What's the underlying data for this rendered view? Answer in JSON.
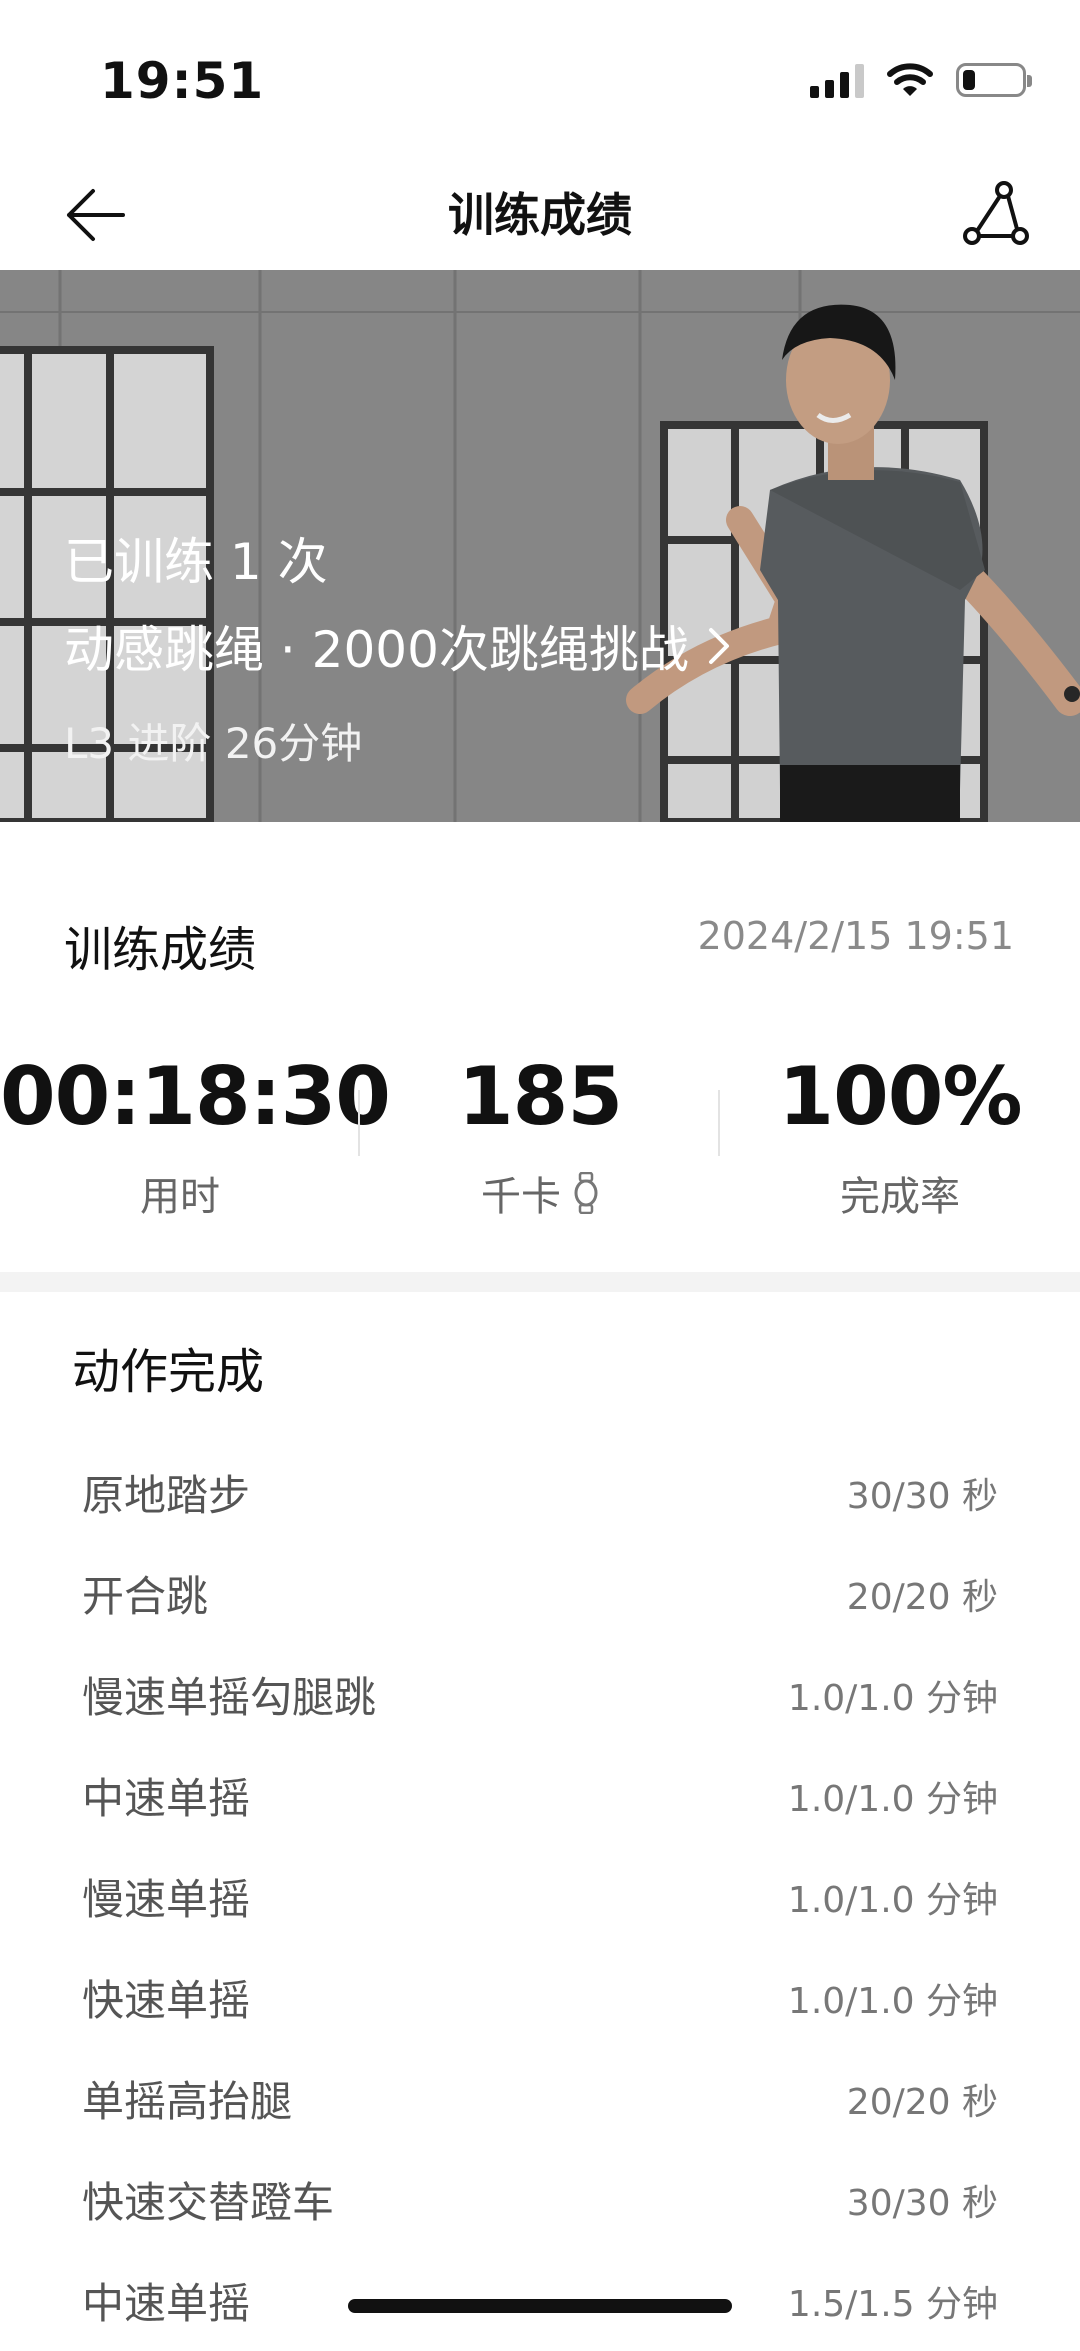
{
  "status_bar": {
    "time": "19:51"
  },
  "header": {
    "title": "训练成绩"
  },
  "hero": {
    "count_text": "已训练 1 次",
    "course_text": "动感跳绳 · 2000次跳绳挑战",
    "level_text": "L3 进阶 26分钟"
  },
  "results": {
    "title": "训练成绩",
    "date": "2024/2/15 19:51",
    "stats": [
      {
        "value": "00:18:30",
        "label": "用时"
      },
      {
        "value": "185",
        "label": "千卡"
      },
      {
        "value": "100%",
        "label": "完成率"
      }
    ]
  },
  "actions": {
    "title": "动作完成",
    "items": [
      {
        "name": "原地踏步",
        "value": "30/30 秒"
      },
      {
        "name": "开合跳",
        "value": "20/20 秒"
      },
      {
        "name": "慢速单摇勾腿跳",
        "value": "1.0/1.0 分钟"
      },
      {
        "name": "中速单摇",
        "value": "1.0/1.0 分钟"
      },
      {
        "name": "慢速单摇",
        "value": "1.0/1.0 分钟"
      },
      {
        "name": "快速单摇",
        "value": "1.0/1.0 分钟"
      },
      {
        "name": "单摇高抬腿",
        "value": "20/20 秒"
      },
      {
        "name": "快速交替蹬车",
        "value": "30/30 秒"
      },
      {
        "name": "中速单摇",
        "value": "1.5/1.5 分钟"
      }
    ]
  }
}
